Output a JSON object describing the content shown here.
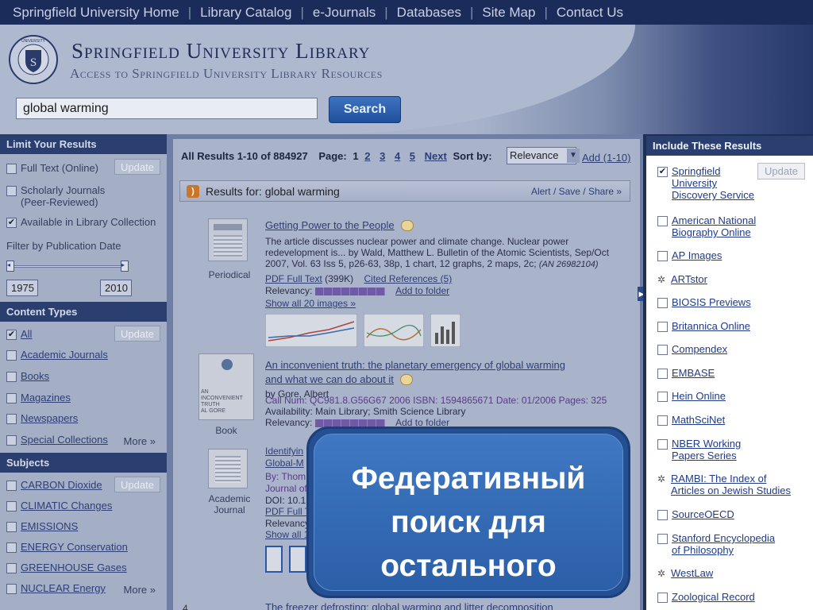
{
  "topnav": [
    "Springfield University Home",
    "Library Catalog",
    "e-Journals",
    "Databases",
    "Site Map",
    "Contact Us"
  ],
  "header": {
    "title": "Springfield University Library",
    "subtitle": "Access to Springfield University Library Resources",
    "seal_text": "SPRINGFIELD UNIVERSITY LIBRARY",
    "search_value": "global warming",
    "search_button": "Search"
  },
  "left": {
    "limit_title": "Limit Your Results",
    "update": "Update",
    "limits": [
      {
        "label": "Full Text (Online)",
        "checked": false
      },
      {
        "label": "Scholarly Journals\n(Peer-Reviewed)",
        "checked": false
      },
      {
        "label": "Available in Library Collection",
        "checked": true
      }
    ],
    "date_label": "Filter by Publication Date",
    "date_from": "1975",
    "date_to": "2010",
    "content_title": "Content Types",
    "content_types": [
      {
        "label": "All",
        "checked": true
      },
      {
        "label": "Academic Journals",
        "checked": false
      },
      {
        "label": "Books",
        "checked": false
      },
      {
        "label": "Magazines",
        "checked": false
      },
      {
        "label": "Newspapers",
        "checked": false
      },
      {
        "label": "Special Collections",
        "checked": false
      }
    ],
    "more": "More »",
    "subjects_title": "Subjects",
    "subjects": [
      {
        "label": "CARBON Dioxide",
        "checked": false
      },
      {
        "label": "CLIMATIC Changes",
        "checked": false
      },
      {
        "label": "EMISSIONS",
        "checked": false
      },
      {
        "label": "ENERGY Conservation",
        "checked": false
      },
      {
        "label": "GREENHOUSE Gases",
        "checked": false
      },
      {
        "label": "NUCLEAR Energy",
        "checked": false
      }
    ]
  },
  "results": {
    "header_label": "All Results 1-10 of 884927",
    "page_label": "Page:",
    "pages": [
      "1",
      "2",
      "3",
      "4",
      "5"
    ],
    "next": "Next",
    "sort_label": "Sort by:",
    "sort_value": "Relevance",
    "add": "Add (1-10)",
    "for_text": "Results for: global warming",
    "alert_links": "Alert / Save / Share »",
    "relevancy": "Relevancy:",
    "add_folder": "Add to folder",
    "items": [
      {
        "type": "Periodical",
        "title": "Getting Power to the People",
        "abstract": "The article discusses nuclear power and climate change. Nuclear power redevelopment is... by Wald, Matthew L. Bulletin of the Atomic Scientists, Sep/Oct 2007, Vol. 63 Iss 5, p26-63, 38p, 1 chart, 12 graphs, 2 maps, 2c;",
        "an": "(AN 26982104)",
        "pdf": "PDF Full Text",
        "size": "(399K)",
        "cited": "Cited References (5)",
        "show_images": "Show all 20 images »"
      },
      {
        "type": "Book",
        "title": "An inconvenient truth: the planetary emergency of global warming and what we can do about it",
        "author": "by Gore, Albert",
        "callnum": "Call Num: QC981.8.G56G67 2006 ISBN: 1594865671 Date: 01/2006 Pages: 325",
        "availability": "Availability: Main Library; Smith Science Library",
        "cover_text": "AN\nINCONVENIENT\nTRUTH\nAL GORE"
      },
      {
        "type": "Academic\nJournal",
        "title": "Identifyin",
        "title2": "Global-M",
        "by": "By: Thom",
        "journal": "Journal of",
        "doi": "DOI: 10.1",
        "pdf": "PDF Full T",
        "relevancy": "Relevancy:",
        "show": "Show all 1"
      },
      {
        "num": "4",
        "title": "The freezer defrosting: global warming and litter decomposition"
      }
    ]
  },
  "right": {
    "title": "Include These Results",
    "update": "Update",
    "items": [
      {
        "label": "Springfield\nUniversity\nDiscovery Service",
        "state": "checked"
      },
      {
        "label": "American National\nBiography Online",
        "state": "unchecked"
      },
      {
        "label": "AP Images",
        "state": "unchecked"
      },
      {
        "label": "ARTstor",
        "state": "loading"
      },
      {
        "label": "BIOSIS Previews",
        "state": "unchecked"
      },
      {
        "label": "Britannica Online",
        "state": "unchecked"
      },
      {
        "label": "Compendex",
        "state": "unchecked"
      },
      {
        "label": "EMBASE",
        "state": "unchecked"
      },
      {
        "label": "Hein Online",
        "state": "unchecked"
      },
      {
        "label": "MathSciNet",
        "state": "unchecked"
      },
      {
        "label": "NBER Working\nPapers Series",
        "state": "unchecked"
      },
      {
        "label": "RAMBI: The Index of\nArticles on Jewish Studies",
        "state": "loading"
      },
      {
        "label": "SourceOECD",
        "state": "unchecked"
      },
      {
        "label": "Stanford Encyclopedia\nof Philosophy",
        "state": "unchecked"
      },
      {
        "label": "WestLaw",
        "state": "loading"
      },
      {
        "label": "Zoological Record",
        "state": "unchecked"
      }
    ]
  },
  "overlay": {
    "text": "Федеративный\nпоиск для\nостального"
  },
  "colors": {
    "nav": "#1c2c5a",
    "section_header": "#2a3e6f",
    "search_button": "#2b5fa8",
    "overlay": "#3f78c3"
  }
}
